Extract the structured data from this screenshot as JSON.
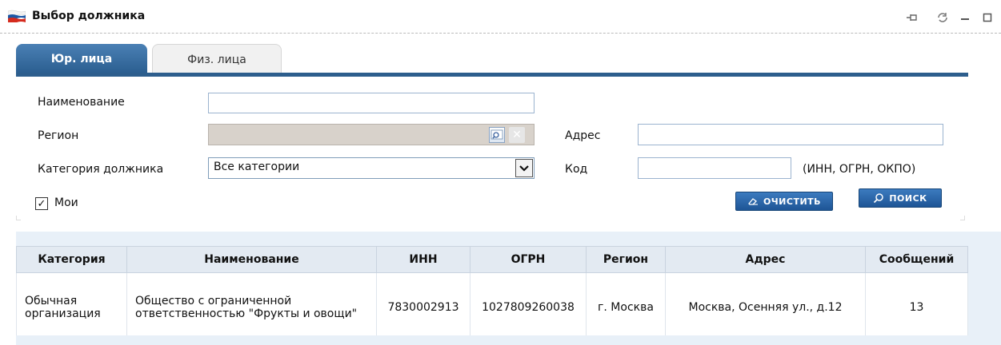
{
  "window": {
    "title": "Выбор должника",
    "flag_colors": [
      "#ffffff",
      "#1c57a5",
      "#d52b1e"
    ]
  },
  "tabs": [
    {
      "label": "Юр. лица",
      "active": true
    },
    {
      "label": "Физ. лица",
      "active": false
    }
  ],
  "form": {
    "name_label": "Наименование",
    "name_value": "",
    "region_label": "Регион",
    "region_value": "",
    "address_label": "Адрес",
    "address_value": "",
    "category_label": "Категория должника",
    "category_selected": "Все категории",
    "code_label": "Код",
    "code_value": "",
    "code_hint": "(ИНН, ОГРН, ОКПО)",
    "mine_label": "Мои",
    "mine_checked": true,
    "clear_label": "очистить",
    "search_label": "поиск"
  },
  "table": {
    "headers": [
      "Категория",
      "Наименование",
      "ИНН",
      "ОГРН",
      "Регион",
      "Адрес",
      "Сообщений"
    ],
    "rows": [
      {
        "category": "Обычная организация",
        "name": "Общество с ограниченной ответственностью \"Фрукты и овощи\"",
        "inn": "7830002913",
        "ogrn": "1027809260038",
        "region": "г. Москва",
        "address": "Москва, Осенняя ул., д.12",
        "messages": "13"
      }
    ]
  },
  "colors": {
    "tab_active": "#2a5d8f",
    "header_bg": "#e3eaf2",
    "button": "#1e5596"
  }
}
